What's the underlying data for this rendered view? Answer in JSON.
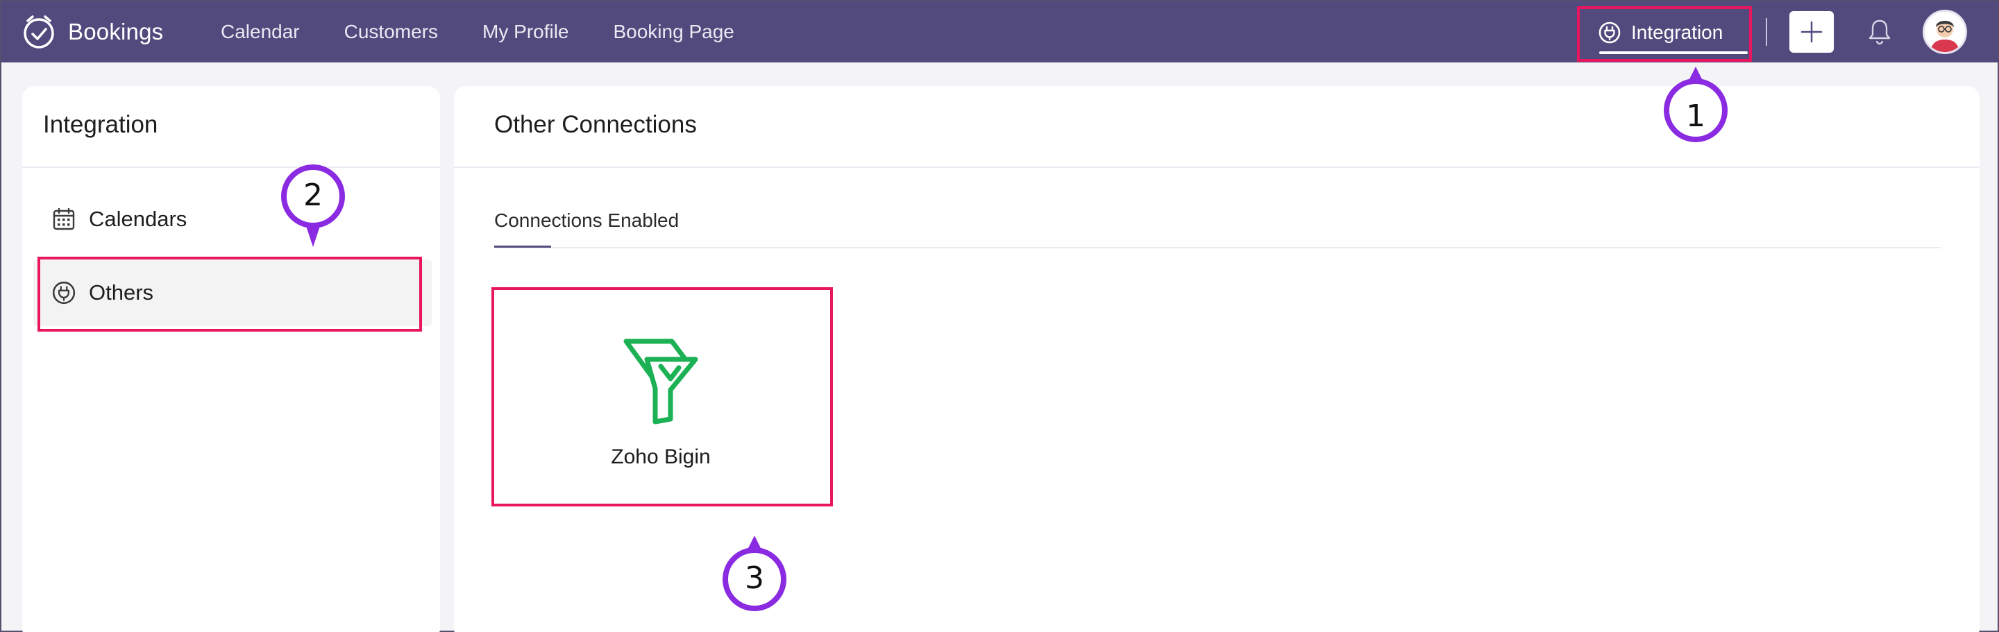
{
  "app": {
    "name": "Bookings"
  },
  "nav": {
    "items": [
      {
        "label": "Calendar"
      },
      {
        "label": "Customers"
      },
      {
        "label": "My Profile"
      },
      {
        "label": "Booking Page"
      }
    ],
    "integration_label": "Integration"
  },
  "sidebar": {
    "title": "Integration",
    "items": [
      {
        "label": "Calendars",
        "icon": "calendar-icon"
      },
      {
        "label": "Others",
        "icon": "plug-icon",
        "active": true
      }
    ]
  },
  "main": {
    "title": "Other Connections",
    "tab": "Connections Enabled",
    "cards": [
      {
        "name": "Zoho Bigin",
        "icon": "zoho-bigin-logo"
      }
    ]
  },
  "callouts": [
    "1",
    "2",
    "3"
  ],
  "colors": {
    "topbar": "#524a7d",
    "highlight": "#e8155f",
    "callout": "#8a2be2",
    "bigin": "#1bb154"
  }
}
